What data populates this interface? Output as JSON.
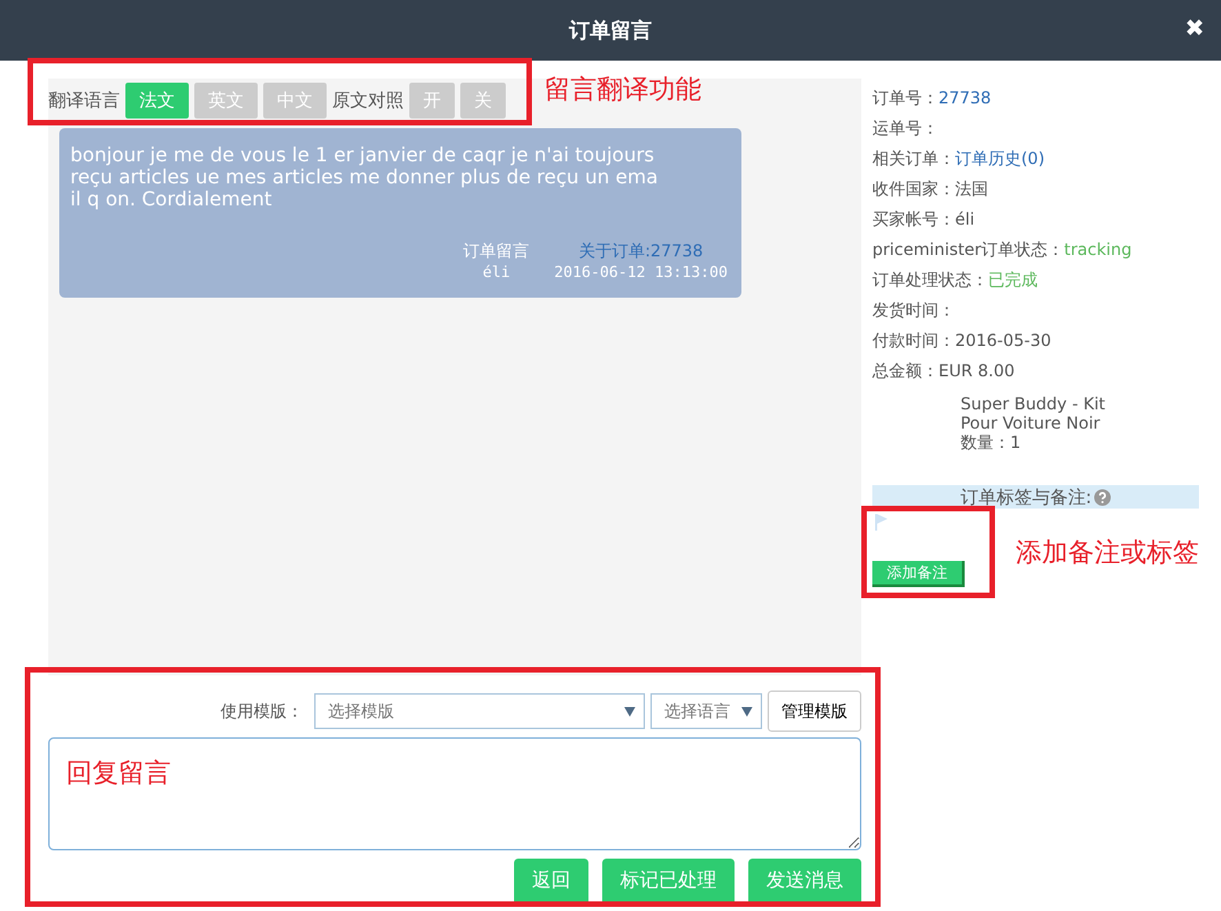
{
  "window": {
    "title": "订单留言",
    "close": "✖"
  },
  "translation": {
    "label": "翻译语言",
    "languages": [
      {
        "label": "法文",
        "selected": true
      },
      {
        "label": "英文",
        "selected": false
      },
      {
        "label": "中文",
        "selected": false
      }
    ],
    "compare_label": "原文对照",
    "compare": [
      {
        "label": "开",
        "selected": false
      },
      {
        "label": "关",
        "selected": false
      }
    ]
  },
  "messages": [
    {
      "text": "bonjour je me de vous le 1 er janvier de  caqr je n'ai toujours reçu articles ue mes articles  me donner plus de  reçu un email q on. Cordialement",
      "type": "订单留言",
      "sender": "éli",
      "about": "关于订单:27738",
      "time": "2016-06-12 13:13:00"
    }
  ],
  "order_info": [
    {
      "label": "订单号：",
      "value": "27738",
      "kind": "link"
    },
    {
      "label": "运单号："
    },
    {
      "label": "相关订单：",
      "value": "订单历史(0)",
      "kind": "link"
    },
    {
      "label": "收件国家：",
      "value": "法国",
      "kind": "plain"
    },
    {
      "label": "买家帐号：",
      "value": "éli",
      "kind": "plain"
    },
    {
      "label": "priceminister订单状态：",
      "value": "tracking",
      "kind": "status"
    },
    {
      "label": "订单处理状态：",
      "value": "已完成",
      "kind": "status"
    },
    {
      "label": "发货时间："
    },
    {
      "label": "付款时间：",
      "value": "2016-05-30",
      "kind": "plain"
    },
    {
      "label": "总金额：",
      "value": "EUR   8.00",
      "kind": "plain"
    }
  ],
  "product": {
    "name": "Super Buddy - Kit Pour Voiture Noir",
    "quantity": "数量：1"
  },
  "tags": {
    "title": "订单标签与备注:",
    "add_button": "添加备注"
  },
  "reply": {
    "template_label": "使用模版：",
    "template_select": "选择模版",
    "language_select": "选择语言",
    "manage_button": "管理模版",
    "buttons": [
      "返回",
      "标记已处理",
      "发送消息"
    ]
  },
  "annotations": [
    {
      "kind": "frame",
      "label": "留言翻译功能"
    },
    {
      "kind": "frame",
      "label": "添加备注或标签"
    },
    {
      "kind": "frame",
      "label": "回复留言"
    }
  ]
}
